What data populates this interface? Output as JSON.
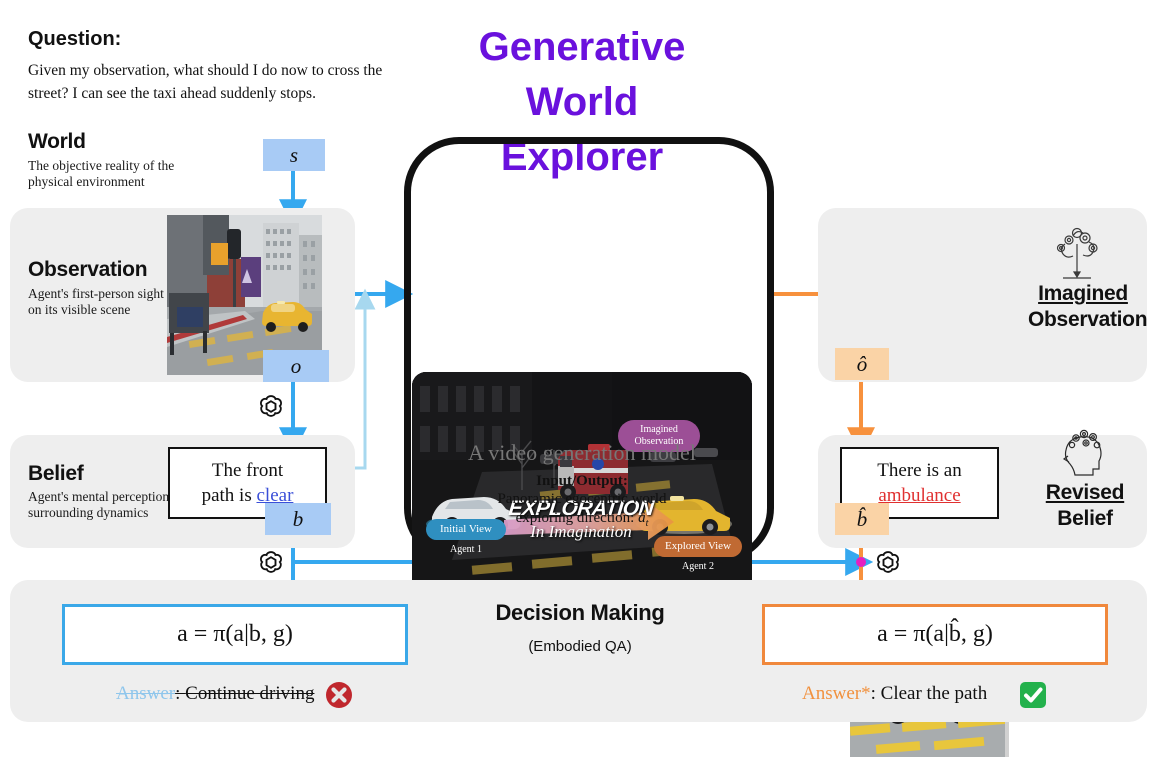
{
  "question": {
    "label": "Question:",
    "text": "Given my observation, what should I do now to cross the street? I can see the taxi ahead suddenly stops."
  },
  "title": "Generative World Explorer",
  "title_lines": [
    "Generative",
    "World",
    "Explorer"
  ],
  "title_color": "#6a11dd",
  "rows": {
    "world": {
      "heading": "World",
      "subtitle": "The objective reality of the physical environment",
      "chip": "s"
    },
    "observation": {
      "heading": "Observation",
      "subtitle": "Agent's first-person sight on its visible scene",
      "chip": "o"
    },
    "belief": {
      "heading": "Belief",
      "subtitle": "Agent's mental perception of surrounding dynamics",
      "box_line1": "The front",
      "box_line2_pre": "path is ",
      "box_line2_link": "clear",
      "chip": "b"
    }
  },
  "center": {
    "video": {
      "imagined_observation_badge": [
        "Imagined",
        "Observation"
      ],
      "exploration_word": "EXPLORATION",
      "exploration_sub": "In Imagination",
      "initial_view_badge": "Initial View",
      "initial_view_agent": "Agent 1",
      "explored_view_badge": "Explored View",
      "explored_view_agent": "Agent 2"
    },
    "caption": "A video generation  model",
    "io_heading": "Input/Output:",
    "io_line1": "Panoramic egocentric world",
    "io_line2_pre": "exploring direction: ",
    "io_line2_sym": "â",
    "io_line2_sub": "t"
  },
  "right": {
    "imagined_observation": {
      "heading_underlined": "Imagined",
      "heading_bold": "Observation",
      "chip": "ô",
      "icon": "imagination-pencil-icon"
    },
    "revised_belief": {
      "heading_underlined": "Revised",
      "heading_bold": "Belief",
      "box_line1": "There is an",
      "box_line2_link": "ambulance",
      "chip": "b̂",
      "icon": "brain-head-icon"
    }
  },
  "decision": {
    "heading": "Decision Making",
    "subtitle": "(Embodied QA)",
    "left": {
      "equation": "a = π(a|b, g)",
      "answer_label": "Answer",
      "answer_sep": ": ",
      "answer_text": "Continue driving",
      "verdict": "wrong",
      "verdict_icon": "cross-icon"
    },
    "right": {
      "equation": "a = π(a|b̂, g)",
      "answer_label": "Answer*",
      "answer_sep": ": ",
      "answer_text": "Clear the path",
      "verdict": "correct",
      "verdict_icon": "check-icon"
    }
  },
  "colors": {
    "accent_purple": "#6a11dd",
    "blue_flow": "#35a8ef",
    "orange_flow": "#f7913d",
    "chip_blue": "#a8cbf5",
    "chip_orange": "#fad3a6",
    "panel_gray": "#eeeeee",
    "magenta_dot": "#e520c0"
  },
  "icons": {
    "llm": "openai-logo-icon"
  }
}
